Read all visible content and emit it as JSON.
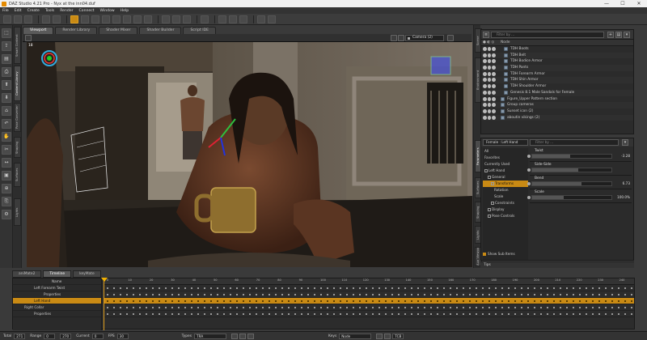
{
  "window": {
    "title": "DAZ Studio 4.21 Pro - Nyx at the inn04.duf",
    "controls": [
      "—",
      "☐",
      "✕"
    ]
  },
  "menu": [
    "File",
    "Edit",
    "Create",
    "Tools",
    "Render",
    "Connect",
    "Window",
    "Help"
  ],
  "toolbar_icons": [
    "new-icon",
    "open-icon",
    "save-icon",
    "sep",
    "undo-icon",
    "redo-icon",
    "sep",
    "universal-tool-icon",
    "translate-tool-icon",
    "rotate-tool-icon",
    "scale-tool-icon",
    "node-selection-icon",
    "surface-selection-icon",
    "geometry-editor-icon",
    "joint-editor-icon",
    "sep",
    "render-icon",
    "render-settings-icon",
    "iray-icon",
    "sep",
    "aux-viewport-icon",
    "sep",
    "pose-tool-icon",
    "camera-tool-icon",
    "light-tool-icon",
    "sep",
    "content-icon",
    "render-library-icon"
  ],
  "left_tools": [
    "⬚",
    "⇪",
    "▤",
    "⎙",
    "⬆",
    "⬇",
    "⌂",
    "↶",
    "✋",
    "✂",
    "↔",
    "▣",
    "⊕",
    "⎘",
    "⚙"
  ],
  "left_tabs": [
    "Smart Content",
    "Content Library",
    "Pose Converter",
    "Shaping",
    "Surfaces",
    "Lights"
  ],
  "viewport": {
    "tabs": [
      "Viewport",
      "Render Library",
      "Shader Mixer",
      "Shader Builder",
      "Script IDE"
    ],
    "active_tab": 0,
    "camera": "Camera (2)",
    "fps": "18"
  },
  "right_tabs": [
    "Scene",
    "Environment",
    "Parameters",
    "Surfaces",
    "Shaping",
    "Lights",
    "Aux Viewport"
  ],
  "scene": {
    "search_placeholder": "Filter by ...",
    "column_header": "Node",
    "nodes": [
      {
        "label": "TDH Boots",
        "indent": 2,
        "alt": false
      },
      {
        "label": "TDH Belt",
        "indent": 2,
        "alt": true
      },
      {
        "label": "TDH Bodice Armor",
        "indent": 2,
        "alt": false
      },
      {
        "label": "TDH Pants",
        "indent": 2,
        "alt": true
      },
      {
        "label": "TDH Forearm Armor",
        "indent": 2,
        "alt": false
      },
      {
        "label": "TDH Shin Armor",
        "indent": 2,
        "alt": true
      },
      {
        "label": "TDH Shoulder Armor",
        "indent": 2,
        "alt": false
      },
      {
        "label": "Genesis 8.1 Male Sandals for Female",
        "indent": 2,
        "alt": true
      },
      {
        "label": "Figure_Upper Pattern section",
        "indent": 1,
        "alt": false
      },
      {
        "label": "Group cameras",
        "indent": 1,
        "alt": true
      },
      {
        "label": "Sunset icon (2)",
        "indent": 1,
        "alt": false
      },
      {
        "label": "aboutin vikings (2)",
        "indent": 1,
        "alt": true
      }
    ]
  },
  "parameters": {
    "figure_select": "Female : Left Hand",
    "search_placeholder": "Filter by ...",
    "tree": [
      {
        "label": "All",
        "indent": 0,
        "sel": false,
        "chk": false
      },
      {
        "label": "Favorites",
        "indent": 0,
        "sel": false,
        "chk": false
      },
      {
        "label": "Currently Used",
        "indent": 0,
        "sel": false,
        "chk": false
      },
      {
        "label": "Left Hand",
        "indent": 0,
        "sel": false,
        "chk": true
      },
      {
        "label": "General",
        "indent": 1,
        "sel": false,
        "chk": true
      },
      {
        "label": "Transforms",
        "indent": 2,
        "sel": true,
        "chk": true
      },
      {
        "label": "Rotation",
        "indent": 3,
        "sel": false,
        "chk": false
      },
      {
        "label": "Scale",
        "indent": 3,
        "sel": false,
        "chk": false
      },
      {
        "label": "Constraints",
        "indent": 2,
        "sel": false,
        "chk": true
      },
      {
        "label": "Display",
        "indent": 1,
        "sel": false,
        "chk": true
      },
      {
        "label": "Pose Controls",
        "indent": 1,
        "sel": false,
        "chk": true
      }
    ],
    "params": [
      {
        "name": "Twist",
        "value": "-3.28",
        "level": 0.48
      },
      {
        "name": "Side-Side",
        "value": "",
        "level": 0.58
      },
      {
        "name": "Bend",
        "value": "6.73",
        "level": 0.62
      },
      {
        "name": "Scale",
        "value": "100.0%",
        "level": 0.4
      }
    ],
    "show_sub_items": "Show Sub Items"
  },
  "tips_label": "Tips",
  "bottom": {
    "tabs": [
      "aniMate2",
      "Timeline",
      "keyMate"
    ],
    "active_tab": 1,
    "tracks": [
      {
        "label": "Name",
        "indent": 0,
        "sel": false,
        "header": true
      },
      {
        "label": "Left Forearm Twist",
        "indent": 2,
        "sel": false,
        "header": false
      },
      {
        "label": "Properties",
        "indent": 3,
        "sel": false,
        "header": false
      },
      {
        "label": "Left Hand",
        "indent": 2,
        "sel": true,
        "header": false
      },
      {
        "label": "Right Collar",
        "indent": 1,
        "sel": false,
        "header": false
      },
      {
        "label": "Properties",
        "indent": 2,
        "sel": false,
        "header": false
      }
    ],
    "ruler_ticks": [
      "0",
      "10",
      "20",
      "30",
      "40",
      "50",
      "60",
      "70",
      "80",
      "90",
      "100",
      "110",
      "120",
      "130",
      "140",
      "150",
      "160",
      "170",
      "180",
      "190",
      "200",
      "210",
      "220",
      "230",
      "240"
    ]
  },
  "status": {
    "total_label": "Total",
    "total": "271",
    "range_label": "Range",
    "range_start": "0",
    "range_end": "270",
    "current_label": "Current",
    "current": "0",
    "fps_label": "FPS",
    "fps": "30",
    "types_label": "Types",
    "types": "TRA",
    "keys_label": "Keys",
    "keys": "Node",
    "zoom": "TCB"
  }
}
